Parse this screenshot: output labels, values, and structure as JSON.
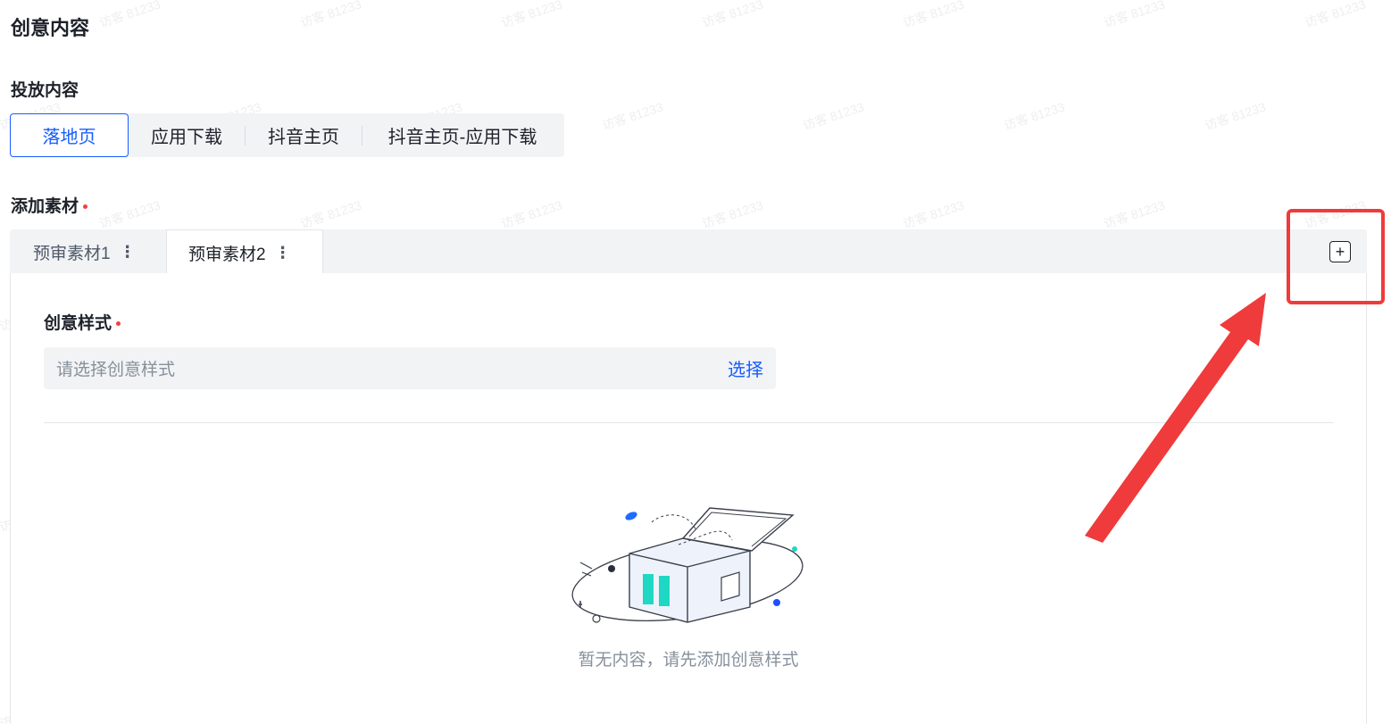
{
  "section": {
    "title": "创意内容"
  },
  "delivery": {
    "label": "投放内容",
    "options": [
      "落地页",
      "应用下载",
      "抖音主页",
      "抖音主页-应用下载"
    ],
    "selected": "落地页"
  },
  "material": {
    "label": "添加素材",
    "tabs": [
      {
        "label": "预审素材1",
        "active": false
      },
      {
        "label": "预审素材2",
        "active": true
      }
    ],
    "add_icon": "plus-square-icon"
  },
  "creative_style": {
    "label": "创意样式",
    "placeholder": "请选择创意样式",
    "select_label": "选择"
  },
  "empty_state": {
    "text": "暂无内容，请先添加创意样式",
    "illustration": "open-box-illustration"
  },
  "watermark": {
    "text": "访客 81233"
  },
  "annotation": {
    "color": "#ef3b3b"
  },
  "colors": {
    "accent": "#165dff",
    "required": "#f53f3f"
  }
}
